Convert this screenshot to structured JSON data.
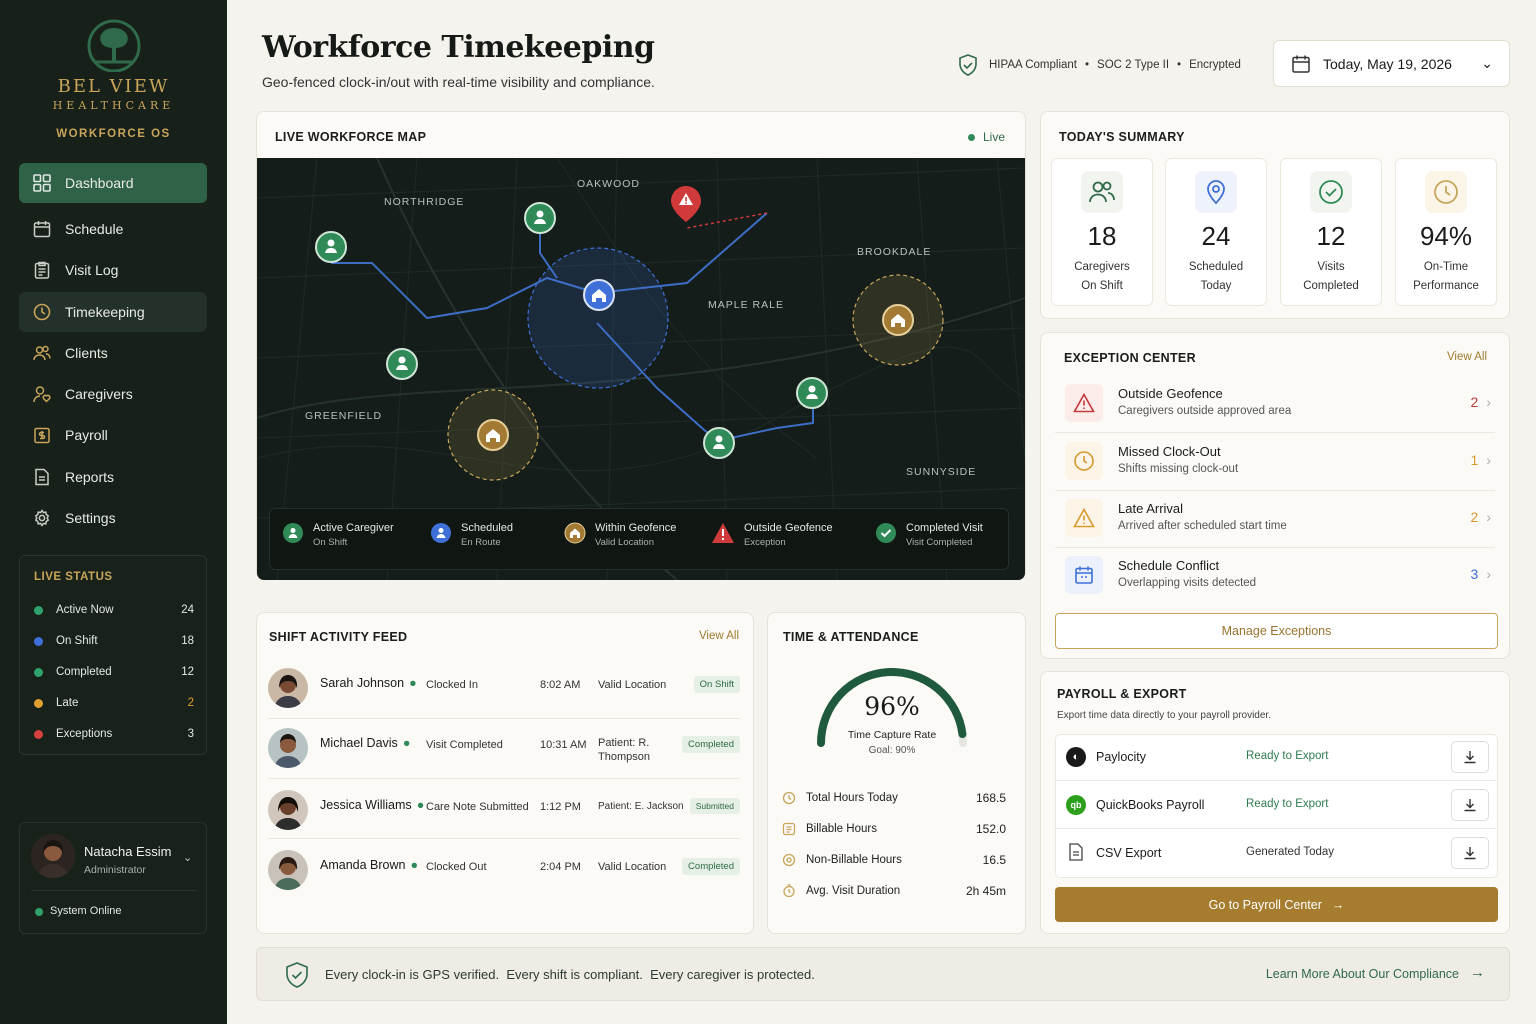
{
  "brand": {
    "name": "BEL VIEW",
    "sub": "HEALTHCARE",
    "os": "WORKFORCE OS"
  },
  "nav": [
    {
      "label": "Dashboard",
      "icon": "grid-icon"
    },
    {
      "label": "Schedule",
      "icon": "calendar-icon"
    },
    {
      "label": "Visit Log",
      "icon": "clipboard-icon"
    },
    {
      "label": "Timekeeping",
      "icon": "clock-icon"
    },
    {
      "label": "Clients",
      "icon": "users-icon"
    },
    {
      "label": "Caregivers",
      "icon": "caregiver-icon"
    },
    {
      "label": "Payroll",
      "icon": "payroll-icon"
    },
    {
      "label": "Reports",
      "icon": "report-icon"
    },
    {
      "label": "Settings",
      "icon": "gear-icon"
    }
  ],
  "live_status": {
    "title": "LIVE STATUS",
    "rows": [
      {
        "label": "Active Now",
        "count": "24",
        "color": "#2fa36b"
      },
      {
        "label": "On Shift",
        "count": "18",
        "color": "#3f6fd8"
      },
      {
        "label": "Completed",
        "count": "12",
        "color": "#2fa36b"
      },
      {
        "label": "Late",
        "count": "2",
        "color": "#e0a030"
      },
      {
        "label": "Exceptions",
        "count": "3",
        "color": "#d64040"
      }
    ]
  },
  "user": {
    "name": "Natacha Essim",
    "role": "Administrator",
    "status": "System Online"
  },
  "header": {
    "title": "Workforce Timekeeping",
    "subtitle": "Geo-fenced clock-in/out with real-time visibility and compliance.",
    "compliance": [
      "HIPAA Compliant",
      "SOC 2 Type II",
      "Encrypted"
    ],
    "date": "Today, May 19, 2026"
  },
  "map": {
    "title": "LIVE WORKFORCE MAP",
    "live": "Live",
    "areas": [
      "NORTHRIDGE",
      "OAKWOOD",
      "BROOKDALE",
      "MAPLE RALE",
      "GREENFIELD",
      "SUNNYSIDE"
    ],
    "legend": [
      {
        "t": "Active Caregiver",
        "s": "On Shift",
        "color": "#2f8a57"
      },
      {
        "t": "Scheduled",
        "s": "En Route",
        "color": "#3f6fd8"
      },
      {
        "t": "Within Geofence",
        "s": "Valid Location",
        "color": "#c8a55a"
      },
      {
        "t": "Outside Geofence",
        "s": "Exception",
        "color": "#d03a3a"
      },
      {
        "t": "Completed Visit",
        "s": "Visit Completed",
        "color": "#2f8a57"
      }
    ]
  },
  "summary": {
    "title": "TODAY'S SUMMARY",
    "items": [
      {
        "num": "18",
        "l1": "Caregivers",
        "l2": "On Shift",
        "icon": "users-icon"
      },
      {
        "num": "24",
        "l1": "Scheduled",
        "l2": "Today",
        "icon": "pin-icon"
      },
      {
        "num": "12",
        "l1": "Visits",
        "l2": "Completed",
        "icon": "check-circle-icon"
      },
      {
        "num": "94%",
        "l1": "On-Time",
        "l2": "Performance",
        "icon": "clock-icon"
      }
    ]
  },
  "exceptions": {
    "title": "EXCEPTION CENTER",
    "view_all": "View All",
    "button": "Manage Exceptions",
    "items": [
      {
        "t": "Outside Geofence",
        "s": "Caregivers outside approved area",
        "n": "2",
        "color": "#c23a3a",
        "bg": "#fbecea"
      },
      {
        "t": "Missed Clock-Out",
        "s": "Shifts missing clock-out",
        "n": "1",
        "color": "#d79a2e",
        "bg": "#fcf4e6"
      },
      {
        "t": "Late Arrival",
        "s": "Arrived after scheduled start time",
        "n": "2",
        "color": "#d79a2e",
        "bg": "#fcf4e6"
      },
      {
        "t": "Schedule Conflict",
        "s": "Overlapping visits detected",
        "n": "3",
        "color": "#3f6fd8",
        "bg": "#ebf0fb"
      }
    ]
  },
  "feed": {
    "title": "SHIFT ACTIVITY FEED",
    "view_all": "View All",
    "rows": [
      {
        "name": "Sarah Johnson",
        "action": "Clocked In",
        "time": "8:02 AM",
        "loc": "Valid Location",
        "status": "On Shift"
      },
      {
        "name": "Michael Davis",
        "action": "Visit Completed",
        "time": "10:31 AM",
        "loc": "Patient: R. Thompson",
        "status": "Completed"
      },
      {
        "name": "Jessica Williams",
        "action": "Care Note Submitted",
        "time": "1:12 PM",
        "loc": "Patient: E. Jackson",
        "status": "Submitted"
      },
      {
        "name": "Amanda Brown",
        "action": "Clocked Out",
        "time": "2:04 PM",
        "loc": "Valid Location",
        "status": "Completed"
      }
    ]
  },
  "attendance": {
    "title": "TIME & ATTENDANCE",
    "rate": 96,
    "rate_text": "96%",
    "rate_label": "Time Capture Rate",
    "goal": "Goal: 90%",
    "rows": [
      {
        "label": "Total Hours Today",
        "v": "168.5"
      },
      {
        "label": "Billable Hours",
        "v": "152.0"
      },
      {
        "label": "Non-Billable Hours",
        "v": "16.5"
      },
      {
        "label": "Avg. Visit Duration",
        "v": "2h 45m"
      }
    ]
  },
  "payroll": {
    "title": "PAYROLL & EXPORT",
    "sub": "Export time data directly to your payroll provider.",
    "button": "Go to Payroll Center",
    "rows": [
      {
        "name": "Paylocity",
        "status": "Ready to Export",
        "green": true
      },
      {
        "name": "QuickBooks Payroll",
        "status": "Ready to Export",
        "green": true
      },
      {
        "name": "CSV Export",
        "status": "Generated Today",
        "green": false
      }
    ]
  },
  "footer": {
    "text": "Every clock-in is GPS verified.  Every shift is compliant.  Every caregiver is protected.",
    "link": "Learn More About Our Compliance"
  }
}
